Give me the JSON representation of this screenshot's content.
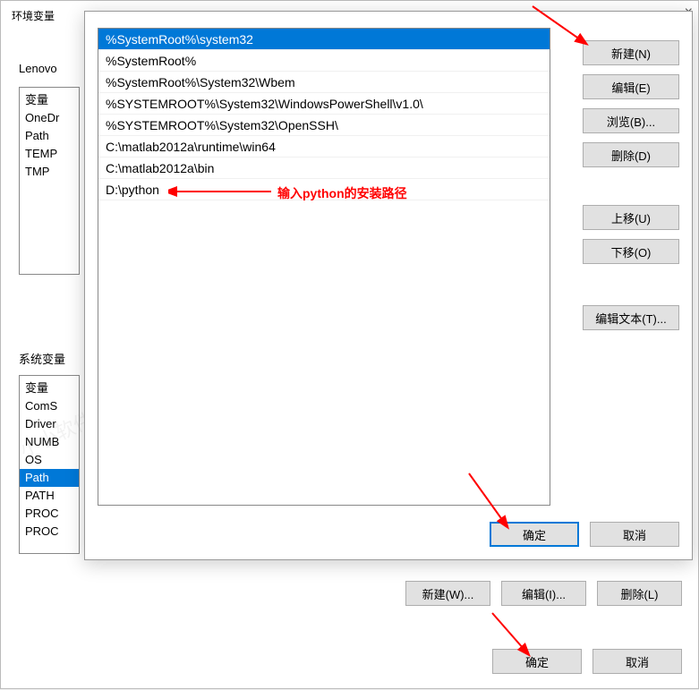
{
  "backDialog": {
    "title": "环境变量",
    "userSectionLabel": "Lenovo",
    "sysSectionLabel": "系统变量",
    "userVars": {
      "header": "变量",
      "items": [
        "OneDr",
        "Path",
        "TEMP",
        "TMP"
      ]
    },
    "sysVars": {
      "header": "变量",
      "items": [
        "ComS",
        "Driver",
        "NUMB",
        "OS",
        "Path",
        "PATH",
        "PROC",
        "PROC"
      ]
    },
    "btnNewW": "新建(W)...",
    "btnEditI": "编辑(I)...",
    "btnDeleteL": "删除(L)",
    "btnOk": "确定",
    "btnCancel": "取消"
  },
  "frontDialog": {
    "paths": [
      "%SystemRoot%\\system32",
      "%SystemRoot%",
      "%SystemRoot%\\System32\\Wbem",
      "%SYSTEMROOT%\\System32\\WindowsPowerShell\\v1.0\\",
      "%SYSTEMROOT%\\System32\\OpenSSH\\",
      "C:\\matlab2012a\\runtime\\win64",
      "C:\\matlab2012a\\bin",
      "D:\\python"
    ],
    "btnNew": "新建(N)",
    "btnEdit": "编辑(E)",
    "btnBrowse": "浏览(B)...",
    "btnDelete": "删除(D)",
    "btnMoveUp": "上移(U)",
    "btnMoveDown": "下移(O)",
    "btnEditText": "编辑文本(T)...",
    "btnOk": "确定",
    "btnCancel": "取消"
  },
  "annotation": {
    "label": "输入python的安装路径"
  },
  "watermark": "小小软件迷 www.xxrjm.com"
}
